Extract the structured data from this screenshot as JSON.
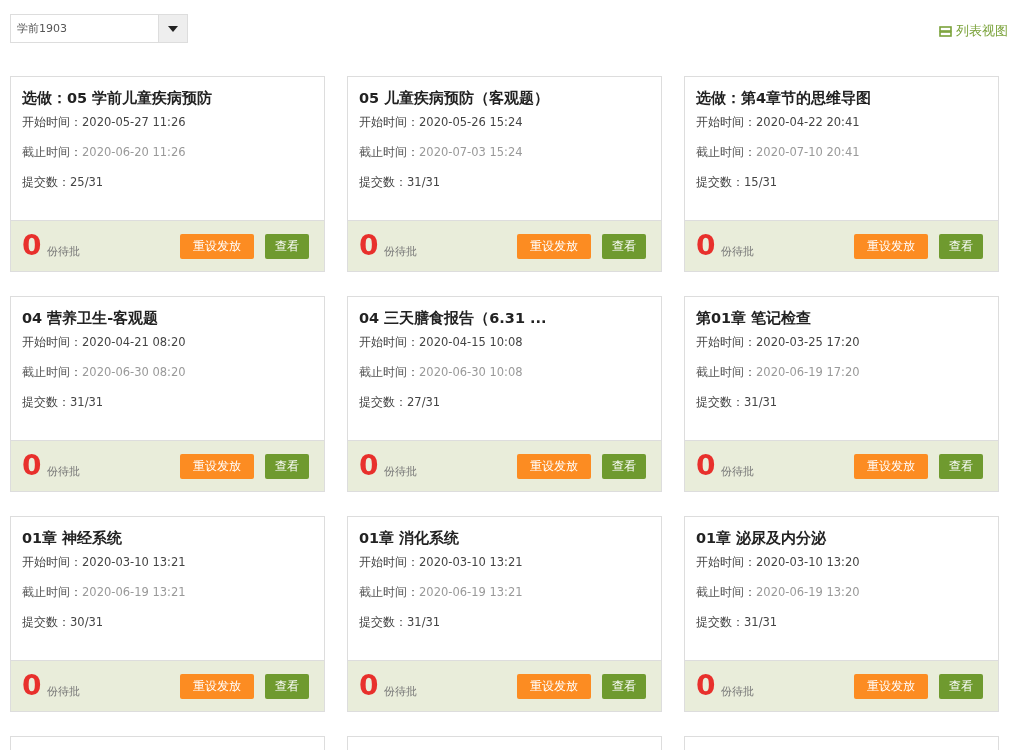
{
  "class_select": {
    "value": "学前1903"
  },
  "view_toggle": {
    "label": "列表视图"
  },
  "cards": [
    {
      "title": "选做：05 学前儿童疾病预防",
      "start_label": "开始时间：",
      "start": "2020-05-27 11:26",
      "end_label": "截止时间：",
      "end": "2020-06-20 11:26",
      "submit_label": "提交数：",
      "submit": "25/31",
      "pending": "0",
      "pending_label": "份待批",
      "reset_button": "重设发放",
      "view_button": "查看"
    },
    {
      "title": "05 儿童疾病预防（客观题）",
      "start_label": "开始时间：",
      "start": "2020-05-26 15:24",
      "end_label": "截止时间：",
      "end": "2020-07-03 15:24",
      "submit_label": "提交数：",
      "submit": "31/31",
      "pending": "0",
      "pending_label": "份待批",
      "reset_button": "重设发放",
      "view_button": "查看"
    },
    {
      "title": "选做：第4章节的思维导图",
      "start_label": "开始时间：",
      "start": "2020-04-22 20:41",
      "end_label": "截止时间：",
      "end": "2020-07-10 20:41",
      "submit_label": "提交数：",
      "submit": "15/31",
      "pending": "0",
      "pending_label": "份待批",
      "reset_button": "重设发放",
      "view_button": "查看"
    },
    {
      "title": "04 营养卫生-客观题",
      "start_label": "开始时间：",
      "start": "2020-04-21 08:20",
      "end_label": "截止时间：",
      "end": "2020-06-30 08:20",
      "submit_label": "提交数：",
      "submit": "31/31",
      "pending": "0",
      "pending_label": "份待批",
      "reset_button": "重设发放",
      "view_button": "查看"
    },
    {
      "title": "04 三天膳食报告（6.31 ...",
      "start_label": "开始时间：",
      "start": "2020-04-15 10:08",
      "end_label": "截止时间：",
      "end": "2020-06-30 10:08",
      "submit_label": "提交数：",
      "submit": "27/31",
      "pending": "0",
      "pending_label": "份待批",
      "reset_button": "重设发放",
      "view_button": "查看"
    },
    {
      "title": "第01章 笔记检查",
      "start_label": "开始时间：",
      "start": "2020-03-25 17:20",
      "end_label": "截止时间：",
      "end": "2020-06-19 17:20",
      "submit_label": "提交数：",
      "submit": "31/31",
      "pending": "0",
      "pending_label": "份待批",
      "reset_button": "重设发放",
      "view_button": "查看"
    },
    {
      "title": "01章 神经系统",
      "start_label": "开始时间：",
      "start": "2020-03-10 13:21",
      "end_label": "截止时间：",
      "end": "2020-06-19 13:21",
      "submit_label": "提交数：",
      "submit": "30/31",
      "pending": "0",
      "pending_label": "份待批",
      "reset_button": "重设发放",
      "view_button": "查看"
    },
    {
      "title": "01章 消化系统",
      "start_label": "开始时间：",
      "start": "2020-03-10 13:21",
      "end_label": "截止时间：",
      "end": "2020-06-19 13:21",
      "submit_label": "提交数：",
      "submit": "31/31",
      "pending": "0",
      "pending_label": "份待批",
      "reset_button": "重设发放",
      "view_button": "查看"
    },
    {
      "title": "01章 泌尿及内分泌",
      "start_label": "开始时间：",
      "start": "2020-03-10 13:20",
      "end_label": "截止时间：",
      "end": "2020-06-19 13:20",
      "submit_label": "提交数：",
      "submit": "31/31",
      "pending": "0",
      "pending_label": "份待批",
      "reset_button": "重设发放",
      "view_button": "查看"
    }
  ]
}
